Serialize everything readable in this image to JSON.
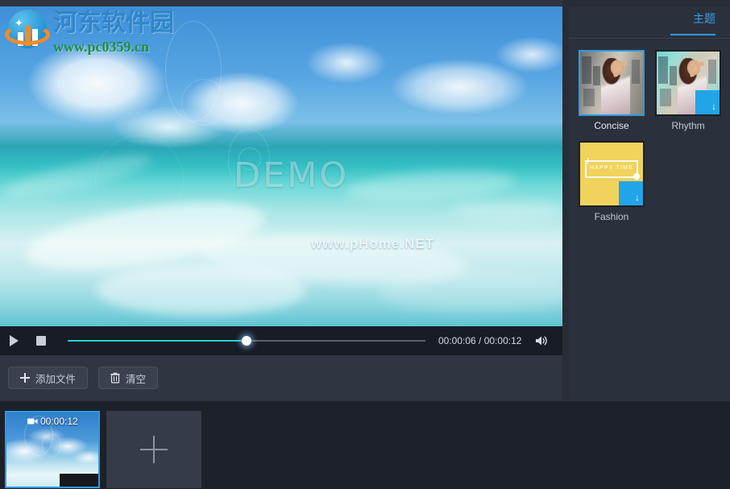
{
  "watermark": {
    "logo_icon": "site-logo-icon",
    "site_name_cn": "河东软件园",
    "site_url": "www.pc0359.cn"
  },
  "preview": {
    "demo_overlay_text": "DEMO",
    "site_overlay_text": "www.pHome.NET"
  },
  "player": {
    "play_icon": "play-icon",
    "stop_icon": "stop-icon",
    "volume_icon": "volume-icon",
    "current_time": "00:00:06",
    "total_time": "00:00:12",
    "time_label": "00:00:06 / 00:00:12",
    "progress_percent": 50,
    "accent_color": "#24d0d8",
    "handle_color": "#ffffff"
  },
  "actions": {
    "add_file_label": "添加文件",
    "add_file_icon": "plus-icon",
    "clear_label": "清空",
    "clear_icon": "trash-icon"
  },
  "timeline": {
    "clips": [
      {
        "duration": "00:00:12",
        "icon": "video-camera-icon",
        "selected": true
      }
    ],
    "add_tile_icon": "plus-icon",
    "selection_color": "#2f9ae0"
  },
  "right_panel": {
    "tabs": [
      {
        "label": "主题",
        "active": true
      }
    ],
    "accent_color": "#2f9ae0",
    "themes": [
      {
        "label": "Concise",
        "selected": true,
        "downloadable": false,
        "style": "concise"
      },
      {
        "label": "Rhythm",
        "selected": false,
        "downloadable": true,
        "style": "rhythm"
      },
      {
        "label": "Fashion",
        "selected": false,
        "downloadable": true,
        "style": "fashion",
        "thumb_text": "HAPPY TIME"
      }
    ],
    "download_badge_icon": "download-arrow-icon",
    "download_badge_color": "#22a4e8"
  },
  "theme_colors": {
    "window_bg": "#272c36",
    "panel_bg": "#2b313c",
    "left_bg": "#2f3541",
    "player_bar_bg": "#181c25",
    "timeline_bg": "#1d212a",
    "button_bg": "#3b414e",
    "text_primary": "#c6ccd6"
  }
}
